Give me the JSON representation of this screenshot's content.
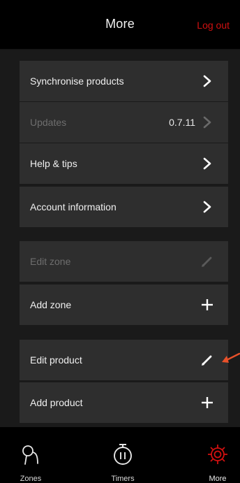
{
  "header": {
    "title": "More",
    "logout_label": "Log out"
  },
  "menu": {
    "synchronise_label": "Synchronise products",
    "updates_label": "Updates",
    "updates_version": "0.7.11",
    "help_label": "Help & tips",
    "account_label": "Account information",
    "edit_zone_label": "Edit zone",
    "add_zone_label": "Add zone",
    "edit_product_label": "Edit product",
    "add_product_label": "Add product"
  },
  "icons": {
    "chevron": "chevron-right-icon",
    "edit": "pencil-icon",
    "add": "plus-icon",
    "zones": "location-pin-icon",
    "timers": "stopwatch-icon",
    "more": "gear-icon"
  },
  "tabs": {
    "zones_label": "Zones",
    "timers_label": "Timers",
    "more_label": "More"
  },
  "colors": {
    "accent_red": "#d01010",
    "annotation_arrow": "#e8512a",
    "row_background": "#2e2e2e",
    "page_background": "#1a1a1a"
  }
}
